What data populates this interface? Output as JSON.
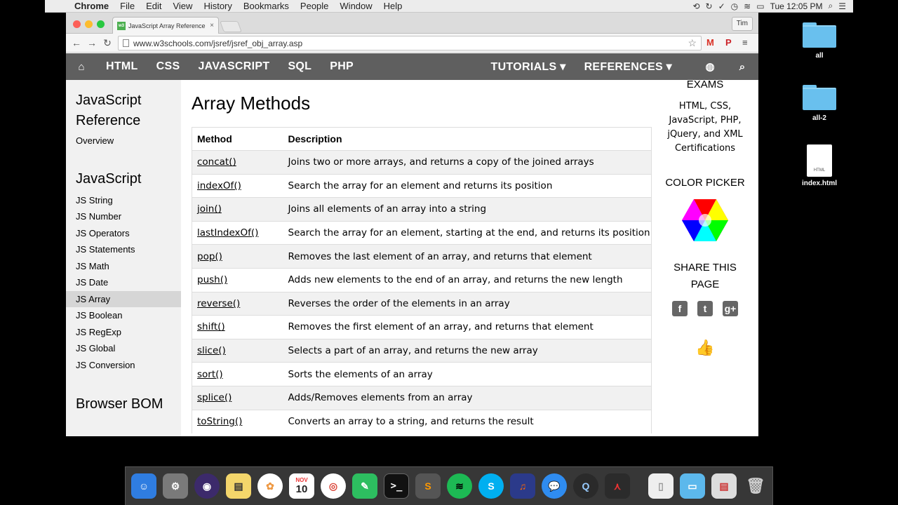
{
  "menubar": {
    "app": "Chrome",
    "items": [
      "File",
      "Edit",
      "View",
      "History",
      "Bookmarks",
      "People",
      "Window",
      "Help"
    ],
    "clock": "Tue 12:05 PM"
  },
  "desktop": {
    "items": [
      {
        "label": "all",
        "type": "folder"
      },
      {
        "label": "all-2",
        "type": "folder"
      },
      {
        "label": "index.html",
        "type": "file",
        "badge": "HTML"
      }
    ]
  },
  "browser": {
    "tab_title": "JavaScript Array Reference",
    "tab_favicon": "w3",
    "profile": "Tim",
    "url": "www.w3schools.com/jsref/jsref_obj_array.asp"
  },
  "w3nav": {
    "left": [
      "HTML",
      "CSS",
      "JAVASCRIPT",
      "SQL",
      "PHP"
    ],
    "tutorials": "TUTORIALS ▾",
    "references": "REFERENCES ▾"
  },
  "sidebar": {
    "heading1_line1": "JavaScript",
    "heading1_line2": "Reference",
    "overview": "Overview",
    "heading2": "JavaScript",
    "links": [
      "JS String",
      "JS Number",
      "JS Operators",
      "JS Statements",
      "JS Math",
      "JS Date",
      "JS Array",
      "JS Boolean",
      "JS RegExp",
      "JS Global",
      "JS Conversion"
    ],
    "active": "JS Array",
    "heading3": "Browser BOM"
  },
  "main": {
    "title": "Array Methods",
    "col_method": "Method",
    "col_description": "Description",
    "rows": [
      {
        "method": "concat()",
        "desc": "Joins two or more arrays, and returns a copy of the joined arrays"
      },
      {
        "method": "indexOf()",
        "desc": "Search the array for an element and returns its position"
      },
      {
        "method": "join()",
        "desc": "Joins all elements of an array into a string"
      },
      {
        "method": "lastIndexOf()",
        "desc": "Search the array for an element, starting at the end, and returns its position"
      },
      {
        "method": "pop()",
        "desc": "Removes the last element of an array, and returns that element"
      },
      {
        "method": "push()",
        "desc": "Adds new elements to the end of an array, and returns the new length"
      },
      {
        "method": "reverse()",
        "desc": "Reverses the order of the elements in an array"
      },
      {
        "method": "shift()",
        "desc": "Removes the first element of an array, and returns that element"
      },
      {
        "method": "slice()",
        "desc": "Selects a part of an array, and returns the new array"
      },
      {
        "method": "sort()",
        "desc": "Sorts the elements of an array"
      },
      {
        "method": "splice()",
        "desc": "Adds/Removes elements from an array"
      },
      {
        "method": "toString()",
        "desc": "Converts an array to a string, and returns the result"
      }
    ]
  },
  "rightcol": {
    "exams": "EXAMS",
    "certs": [
      "HTML, CSS,",
      "JavaScript, PHP,",
      "jQuery, and XML",
      "Certifications"
    ],
    "color_picker": "COLOR PICKER",
    "share_line1": "SHARE THIS",
    "share_line2": "PAGE"
  },
  "dock": {
    "calendar_month": "NOV",
    "calendar_day": "10"
  },
  "colors": {
    "w3_nav": "#5f5f5f",
    "sidebar_bg": "#f1f1f1",
    "row_alt": "#f1f1f1",
    "w3_green": "#4caf50"
  }
}
